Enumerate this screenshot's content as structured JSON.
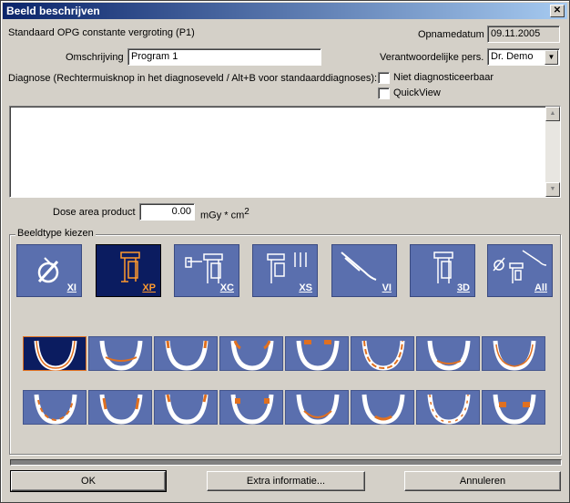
{
  "window": {
    "title": "Beeld beschrijven",
    "close_glyph": "✕"
  },
  "header": {
    "subtitle": "Standaard OPG constante vergroting (P1)",
    "date_label": "Opnamedatum",
    "date_value": "09.11.2005",
    "description_label": "Omschrijving",
    "description_value": "Program 1",
    "responsible_label": "Verantwoordelijke pers.",
    "responsible_value": "Dr. Demo"
  },
  "diagnosis": {
    "label": "Diagnose (Rechtermuisknop in het diagnoseveld / Alt+B voor standaarddiagnoses):",
    "value": "",
    "not_diagnostic_label": "Niet diagnosticeerbaar",
    "quickview_label": "QuickView"
  },
  "dose": {
    "label": "Dose area product",
    "value": "0.00",
    "unit": "mGy * cm",
    "unit_sup": "2"
  },
  "image_type": {
    "group_title": "Beeldtype kiezen",
    "types": [
      {
        "code": "XI",
        "icon": "intraoral-icon"
      },
      {
        "code": "XP",
        "icon": "panoramic-icon"
      },
      {
        "code": "XC",
        "icon": "cephalometric-icon"
      },
      {
        "code": "XS",
        "icon": "scanner-icon"
      },
      {
        "code": "VI",
        "icon": "intraoral-camera-icon"
      },
      {
        "code": "3D",
        "icon": "3d-icon"
      },
      {
        "code": "All",
        "icon": "all-types-icon"
      }
    ],
    "selected_type": "XP",
    "selected_thumbnail_index": 0
  },
  "buttons": {
    "ok": "OK",
    "extra": "Extra informatie...",
    "cancel": "Annuleren"
  },
  "colors": {
    "tile": "#5a6fae",
    "selected_tile": "#0b1c60",
    "accent": "#ff9a2e",
    "title_bar": "#0a246a"
  }
}
